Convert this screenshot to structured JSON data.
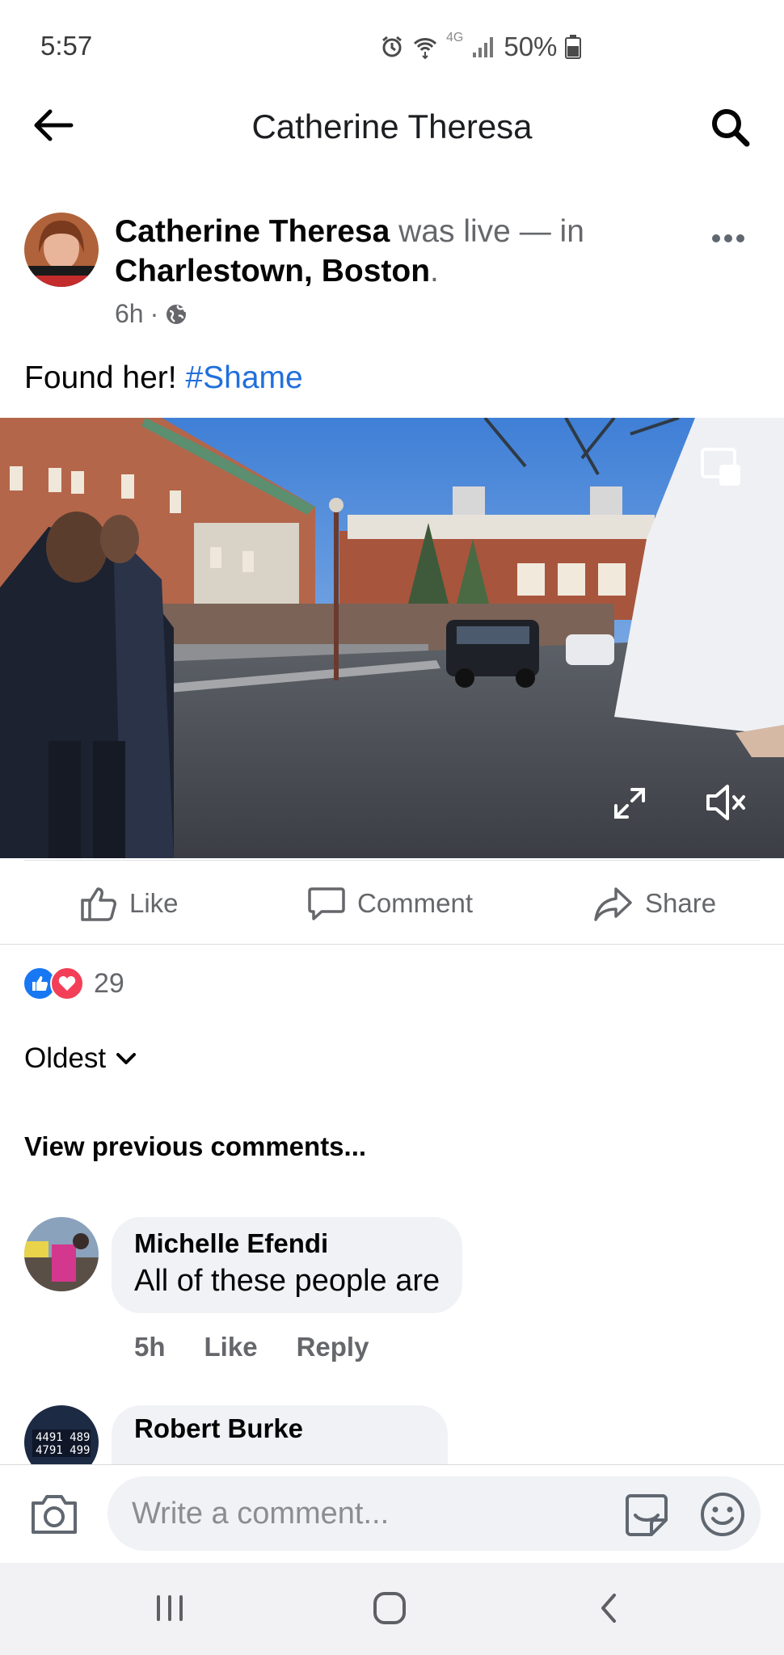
{
  "status_bar": {
    "time": "5:57",
    "network": "4G",
    "battery": "50%"
  },
  "nav": {
    "title": "Catherine Theresa"
  },
  "post": {
    "author": "Catherine Theresa",
    "was_live": "was live — in",
    "location": "Charlestown, Boston",
    "period": ".",
    "time": "6h",
    "separator": "·",
    "text": "Found her!",
    "hashtag": "#Shame"
  },
  "actions": {
    "like": "Like",
    "comment": "Comment",
    "share": "Share"
  },
  "reactions": {
    "count": "29"
  },
  "comments_sort": "Oldest",
  "view_previous": "View previous comments...",
  "comments": [
    {
      "name": "Michelle Efendi",
      "text": "All of these people are",
      "time": "5h",
      "like": "Like",
      "reply": "Reply"
    },
    {
      "name": "Robert Burke"
    }
  ],
  "composer": {
    "placeholder": "Write a comment..."
  },
  "colors": {
    "link": "#216fdb",
    "like_blue": "#1877f2",
    "love_red": "#f33e58",
    "bubble": "#f0f2f5"
  }
}
